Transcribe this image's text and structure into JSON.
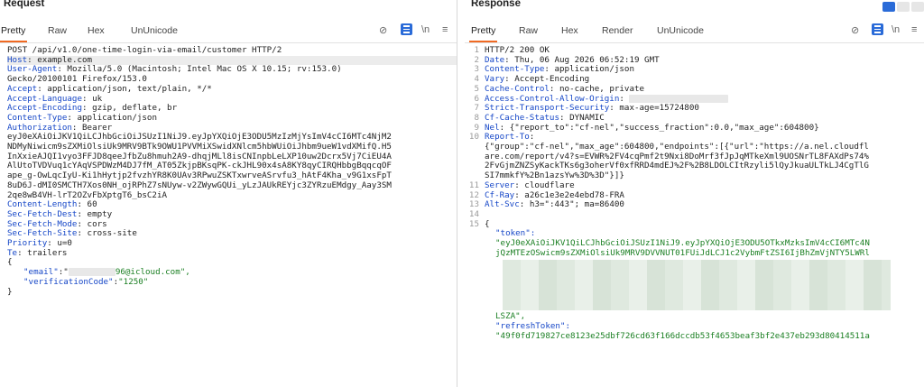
{
  "request": {
    "title": "Request",
    "tabs": [
      "Pretty",
      "Raw",
      "Hex",
      "UnUnicode"
    ],
    "active_tab": "Pretty",
    "toolbar": {
      "eye_off_icon": "eye-off-icon",
      "wrap_icon": "wrap-icon",
      "newline_label": "\\n",
      "menu_icon": "menu-icon"
    },
    "lines": [
      {
        "k": "",
        "v": "POST /api/v1.0/one-time-login-via-email/customer HTTP/2"
      },
      {
        "k": "Host",
        "v": "example.com"
      },
      {
        "k": "User-Agent",
        "v": "Mozilla/5.0 (Macintosh; Intel Mac OS X 10.15; rv:153.0)"
      },
      {
        "k": "",
        "v": "Gecko/20100101 Firefox/153.0"
      },
      {
        "k": "Accept",
        "v": "application/json, text/plain, */*"
      },
      {
        "k": "Accept-Language",
        "v": "uk"
      },
      {
        "k": "Accept-Encoding",
        "v": "gzip, deflate, br"
      },
      {
        "k": "Content-Type",
        "v": "application/json"
      },
      {
        "k": "Authorization",
        "v": "Bearer"
      },
      {
        "k": "",
        "v": "eyJ0eXAiOiJKV1QiLCJhbGciOiJSUzI1NiJ9.eyJpYXQiOjE3ODU5MzIzMjYsImV4cCI6MTc4NjM2"
      },
      {
        "k": "",
        "v": "NDMyNiwicm9sZXMiOlsiUk9MRV9BTk9OWU1PVVMiXSwidXNlcm5hbWUiOiJhbm9ueW1vdXMifQ.H5"
      },
      {
        "k": "",
        "v": "InXxieAJQI1vyo3FFJD8qeeJfbZu8hmuh2A9-dhqjMLl8isCNInpbLeLXP10uw2Dcrx5Vj7CiEU4A"
      },
      {
        "k": "",
        "v": "AlUtoTVDVuq1cYAqVSPDWzM4DJ7fM_AT05ZkjpBKsqPK-ckJHL90x4sA8KY8qyCIRQHbbgBqqcqOF"
      },
      {
        "k": "",
        "v": "ape_g-OwLqcIyU-Ki1hHytjp2fvzhYR8K0UAv3RPwuZSKTxwrveASrvfu3_hAtF4Kha_v9G1xsFpT"
      },
      {
        "k": "",
        "v": "8uD6J-dMI0SMCTH7Xos0NH_ojRPhZ7sNUyw-v2ZWywGQUi_yLzJAUkREYjc3ZYRzuEMdgy_Aay3SM"
      },
      {
        "k": "",
        "v": "2qe8wB4VH-lrT2OZvFbXptgT6_bsC2iA"
      },
      {
        "k": "Content-Length",
        "v": "60"
      },
      {
        "k": "Sec-Fetch-Dest",
        "v": "empty"
      },
      {
        "k": "Sec-Fetch-Mode",
        "v": "cors"
      },
      {
        "k": "Sec-Fetch-Site",
        "v": "cross-site"
      },
      {
        "k": "Priority",
        "v": "u=0"
      },
      {
        "k": "Te",
        "v": "trailers"
      },
      {
        "k": "",
        "v": ""
      },
      {
        "k": "",
        "v": "{"
      }
    ],
    "body": {
      "email_key": "\"email\"",
      "email_value_suffix": "96@icloud.com\",",
      "code_key": "\"verificationCode\"",
      "code_value": "\"1250\"",
      "close": "}"
    }
  },
  "response": {
    "title": "Response",
    "tabs": [
      "Pretty",
      "Raw",
      "Hex",
      "Render",
      "UnUnicode"
    ],
    "active_tab": "Pretty",
    "toolbar": {
      "eye_off_icon": "eye-off-icon",
      "wrap_icon": "wrap-icon",
      "newline_label": "\\n",
      "menu_icon": "menu-icon"
    },
    "layout_buttons": [
      "split-horizontal",
      "split-vertical",
      "single-panel"
    ],
    "lines": [
      {
        "n": "1",
        "k": "",
        "v": "HTTP/2 200 OK"
      },
      {
        "n": "2",
        "k": "Date",
        "v": "Thu, 06 Aug 2026 06:52:19 GMT"
      },
      {
        "n": "3",
        "k": "Content-Type",
        "v": "application/json"
      },
      {
        "n": "4",
        "k": "Vary",
        "v": "Accept-Encoding"
      },
      {
        "n": "5",
        "k": "Cache-Control",
        "v": "no-cache, private"
      },
      {
        "n": "6",
        "k": "Access-Control-Allow-Origin",
        "v": ""
      },
      {
        "n": "7",
        "k": "Strict-Transport-Security",
        "v": "max-age=15724800"
      },
      {
        "n": "8",
        "k": "Cf-Cache-Status",
        "v": "DYNAMIC"
      },
      {
        "n": "9",
        "k": "Nel",
        "v": "{\"report_to\":\"cf-nel\",\"success_fraction\":0.0,\"max_age\":604800}"
      },
      {
        "n": "10",
        "k": "Report-To",
        "v": ""
      },
      {
        "n": "",
        "k": "",
        "v": "{\"group\":\"cf-nel\",\"max_age\":604800,\"endpoints\":[{\"url\":\"https://a.nel.cloudfl"
      },
      {
        "n": "",
        "k": "",
        "v": "are.com/report/v4?s=EVWR%2FV4cqPmf2t9Nxi8DoMrf3fJpJqMTkeXml9UOSNrTL8FAXdPs74%"
      },
      {
        "n": "",
        "k": "",
        "v": "2FvGjmZNZSyKackTKs6g3oherVf0xfRRD4mdEJ%2F%2B8LDOLCItRzyli5lQyJkuaULTkLJ4CgTlG"
      },
      {
        "n": "",
        "k": "",
        "v": "SI7mmkfY%2Bn1azsYw%3D%3D\"}]}"
      },
      {
        "n": "11",
        "k": "Server",
        "v": "cloudflare"
      },
      {
        "n": "12",
        "k": "Cf-Ray",
        "v": "a26c1e3e2e4ebd78-FRA"
      },
      {
        "n": "13",
        "k": "Alt-Svc",
        "v": "h3=\":443\"; ma=86400"
      },
      {
        "n": "14",
        "k": "",
        "v": ""
      },
      {
        "n": "15",
        "k": "",
        "v": "{"
      }
    ],
    "json_body": {
      "token_key": "\"token\":",
      "token_line1": "\"eyJ0eXAiOiJKV1QiLCJhbGciOiJSUzI1NiJ9.eyJpYXQiOjE3ODU5OTkxMzksImV4cCI6MTc4N",
      "token_line2": "jQzMTEzOSwicm9sZXMiOlsiUk9MRV9DVVNUT01FUiJdLCJ1c2VybmFtZSI6IjBhZmVjNTY5LWRl",
      "token_end": "LSZA\",",
      "refresh_key": "\"refreshToken\":",
      "refresh_value": "\"49f0fd719827ce8123e25dbf726cd63f166dccdb53f4653beaf3bf2e437eb293d80414511a"
    }
  }
}
